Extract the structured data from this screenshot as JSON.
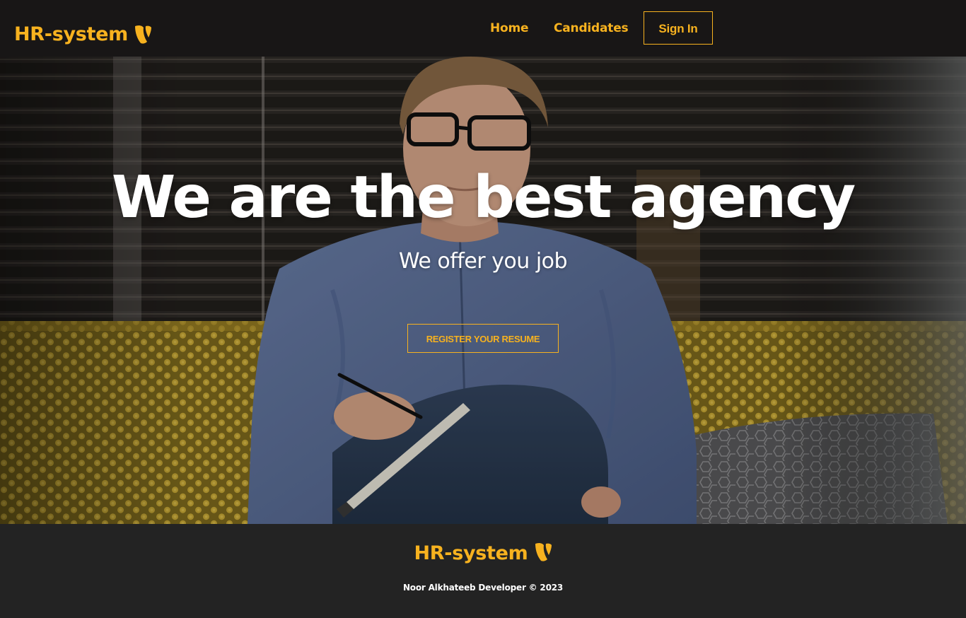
{
  "brand": {
    "name": "HR-system",
    "logo_icon": "typo3-shield-icon",
    "accent_color": "#f7b21f"
  },
  "nav": {
    "links": [
      {
        "label": "Home"
      },
      {
        "label": "Candidates"
      }
    ],
    "signin_label": "Sign In"
  },
  "hero": {
    "title": "We are the best agency",
    "subtitle": "We offer you job",
    "cta_label": "REGISTER YOUR RESUME",
    "background": "photo-man-writing-on-sofa"
  },
  "footer": {
    "brand_name": "HR-system",
    "credit": "Noor Alkhateeb Developer © 2023"
  },
  "colors": {
    "navbar_bg": "#181616",
    "footer_bg": "#232323",
    "text_light": "#ffffff"
  }
}
